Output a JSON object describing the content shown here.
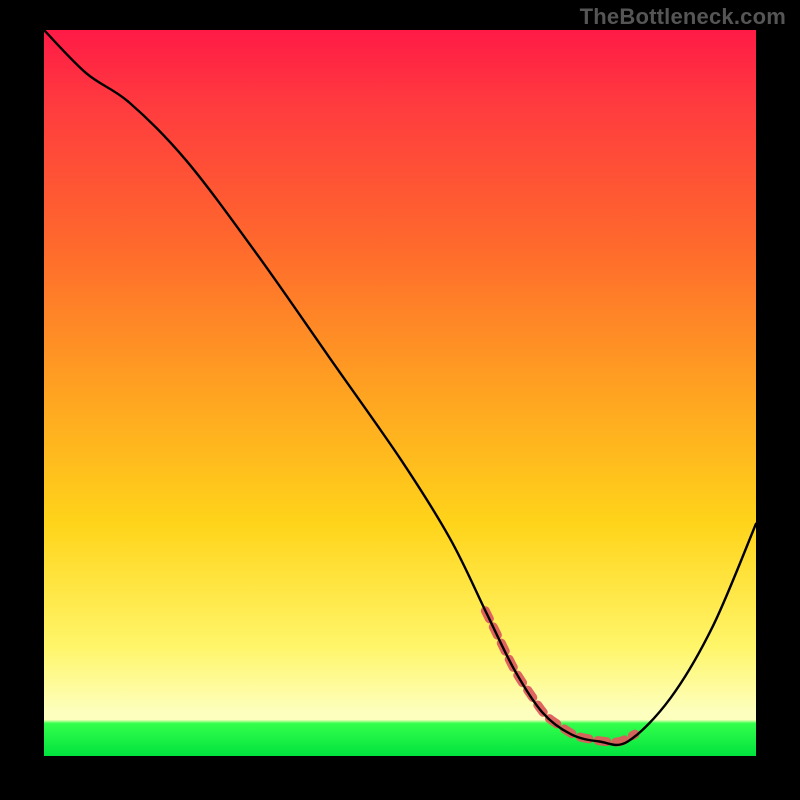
{
  "watermark": "TheBottleneck.com",
  "chart_data": {
    "type": "line",
    "title": "",
    "xlabel": "",
    "ylabel": "",
    "xlim": [
      0,
      100
    ],
    "ylim": [
      0,
      100
    ],
    "grid": false,
    "legend": false,
    "series": [
      {
        "name": "bottleneck-curve",
        "x": [
          0,
          6,
          12,
          20,
          30,
          40,
          50,
          57,
          62,
          66,
          70,
          74,
          78,
          82,
          88,
          94,
          100
        ],
        "values": [
          100,
          94,
          90,
          82,
          69,
          55,
          41,
          30,
          20,
          12,
          6,
          3,
          2,
          2,
          8,
          18,
          32
        ]
      }
    ],
    "valley_highlight": {
      "comment": "dashed coral segment near the curve minimum",
      "x_start": 62,
      "x_end": 83
    },
    "background_gradient": {
      "stops": [
        {
          "pos": 0.0,
          "color": "#ff1a46"
        },
        {
          "pos": 0.3,
          "color": "#ff6a2c"
        },
        {
          "pos": 0.68,
          "color": "#ffd41a"
        },
        {
          "pos": 0.94,
          "color": "#fdffbe"
        },
        {
          "pos": 0.955,
          "color": "#34ff4c"
        },
        {
          "pos": 1.0,
          "color": "#00e23e"
        }
      ]
    }
  }
}
